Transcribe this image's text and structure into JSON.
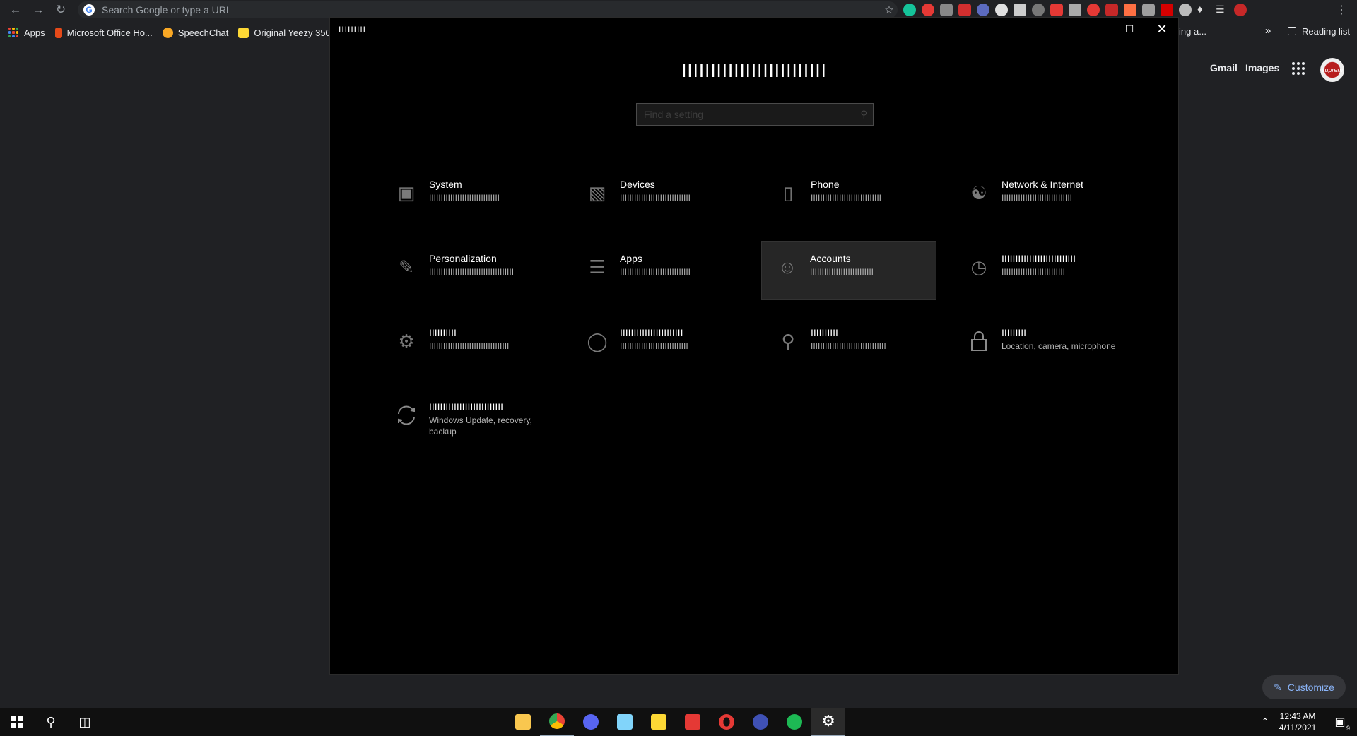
{
  "browser": {
    "omnibox_placeholder": "Search Google or type a URL",
    "bookmarks": [
      {
        "label": "Apps"
      },
      {
        "label": "Microsoft Office Ho..."
      },
      {
        "label": "SpeechChat"
      },
      {
        "label": "Original Yeezy 350..."
      }
    ],
    "bookmark_partial": "ing a...",
    "overflow": "»",
    "reading_list": "Reading list"
  },
  "newtab": {
    "gmail": "Gmail",
    "images": "Images",
    "avatar_text": "suprem",
    "customize": "Customize"
  },
  "settings": {
    "window_title": "IIIIIIIII",
    "page_title": "IIIIIIIIIIIIIIIIIIIIIIIII",
    "search_placeholder": "Find a setting",
    "tiles": [
      {
        "name": "System",
        "desc": "IIIIIIIIIIIIIIIIIIIIIIIIIIIIII",
        "icon": "monitor-icon"
      },
      {
        "name": "Devices",
        "desc": "IIIIIIIIIIIIIIIIIIIIIIIIIIIIII",
        "icon": "devices-icon"
      },
      {
        "name": "Phone",
        "desc": "IIIIIIIIIIIIIIIIIIIIIIIIIIIIII",
        "icon": "phone-icon"
      },
      {
        "name": "Network & Internet",
        "desc": "IIIIIIIIIIIIIIIIIIIIIIIIIIIIII",
        "icon": "globe-icon"
      },
      {
        "name": "Personalization",
        "desc": "IIIIIIIIIIIIIIIIIIIIIIIIIIIIIIIIIIII",
        "icon": "brush-icon"
      },
      {
        "name": "Apps",
        "desc": "IIIIIIIIIIIIIIIIIIIIIIIIIIIIII",
        "icon": "apps-list-icon"
      },
      {
        "name": "Accounts",
        "desc": "IIIIIIIIIIIIIIIIIIIIIIIIIII",
        "icon": "person-icon"
      },
      {
        "name": "IIIIIIIIIIIIIIIIIIIIIIIIIII",
        "desc": "IIIIIIIIIIIIIIIIIIIIIIIIIII",
        "icon": "time-language-icon"
      },
      {
        "name": "IIIIIIIIII",
        "desc": "IIIIIIIIIIIIIIIIIIIIIIIIIIIIIIIIII",
        "icon": "gaming-icon"
      },
      {
        "name": "IIIIIIIIIIIIIIIIIIIIIII",
        "desc": "IIIIIIIIIIIIIIIIIIIIIIIIIIIII",
        "icon": "ease-of-access-icon"
      },
      {
        "name": "IIIIIIIIII",
        "desc": "IIIIIIIIIIIIIIIIIIIIIIIIIIIIIIII",
        "icon": "search-icon"
      },
      {
        "name": "IIIIIIIII",
        "desc": "Location, camera, microphone",
        "icon": "lock-icon"
      },
      {
        "name": "IIIIIIIIIIIIIIIIIIIIIIIIIII",
        "desc": "Windows Update, recovery, backup",
        "icon": "update-icon"
      }
    ]
  },
  "taskbar": {
    "time": "12:43 AM",
    "date": "4/11/2021",
    "notification_count": "9"
  }
}
